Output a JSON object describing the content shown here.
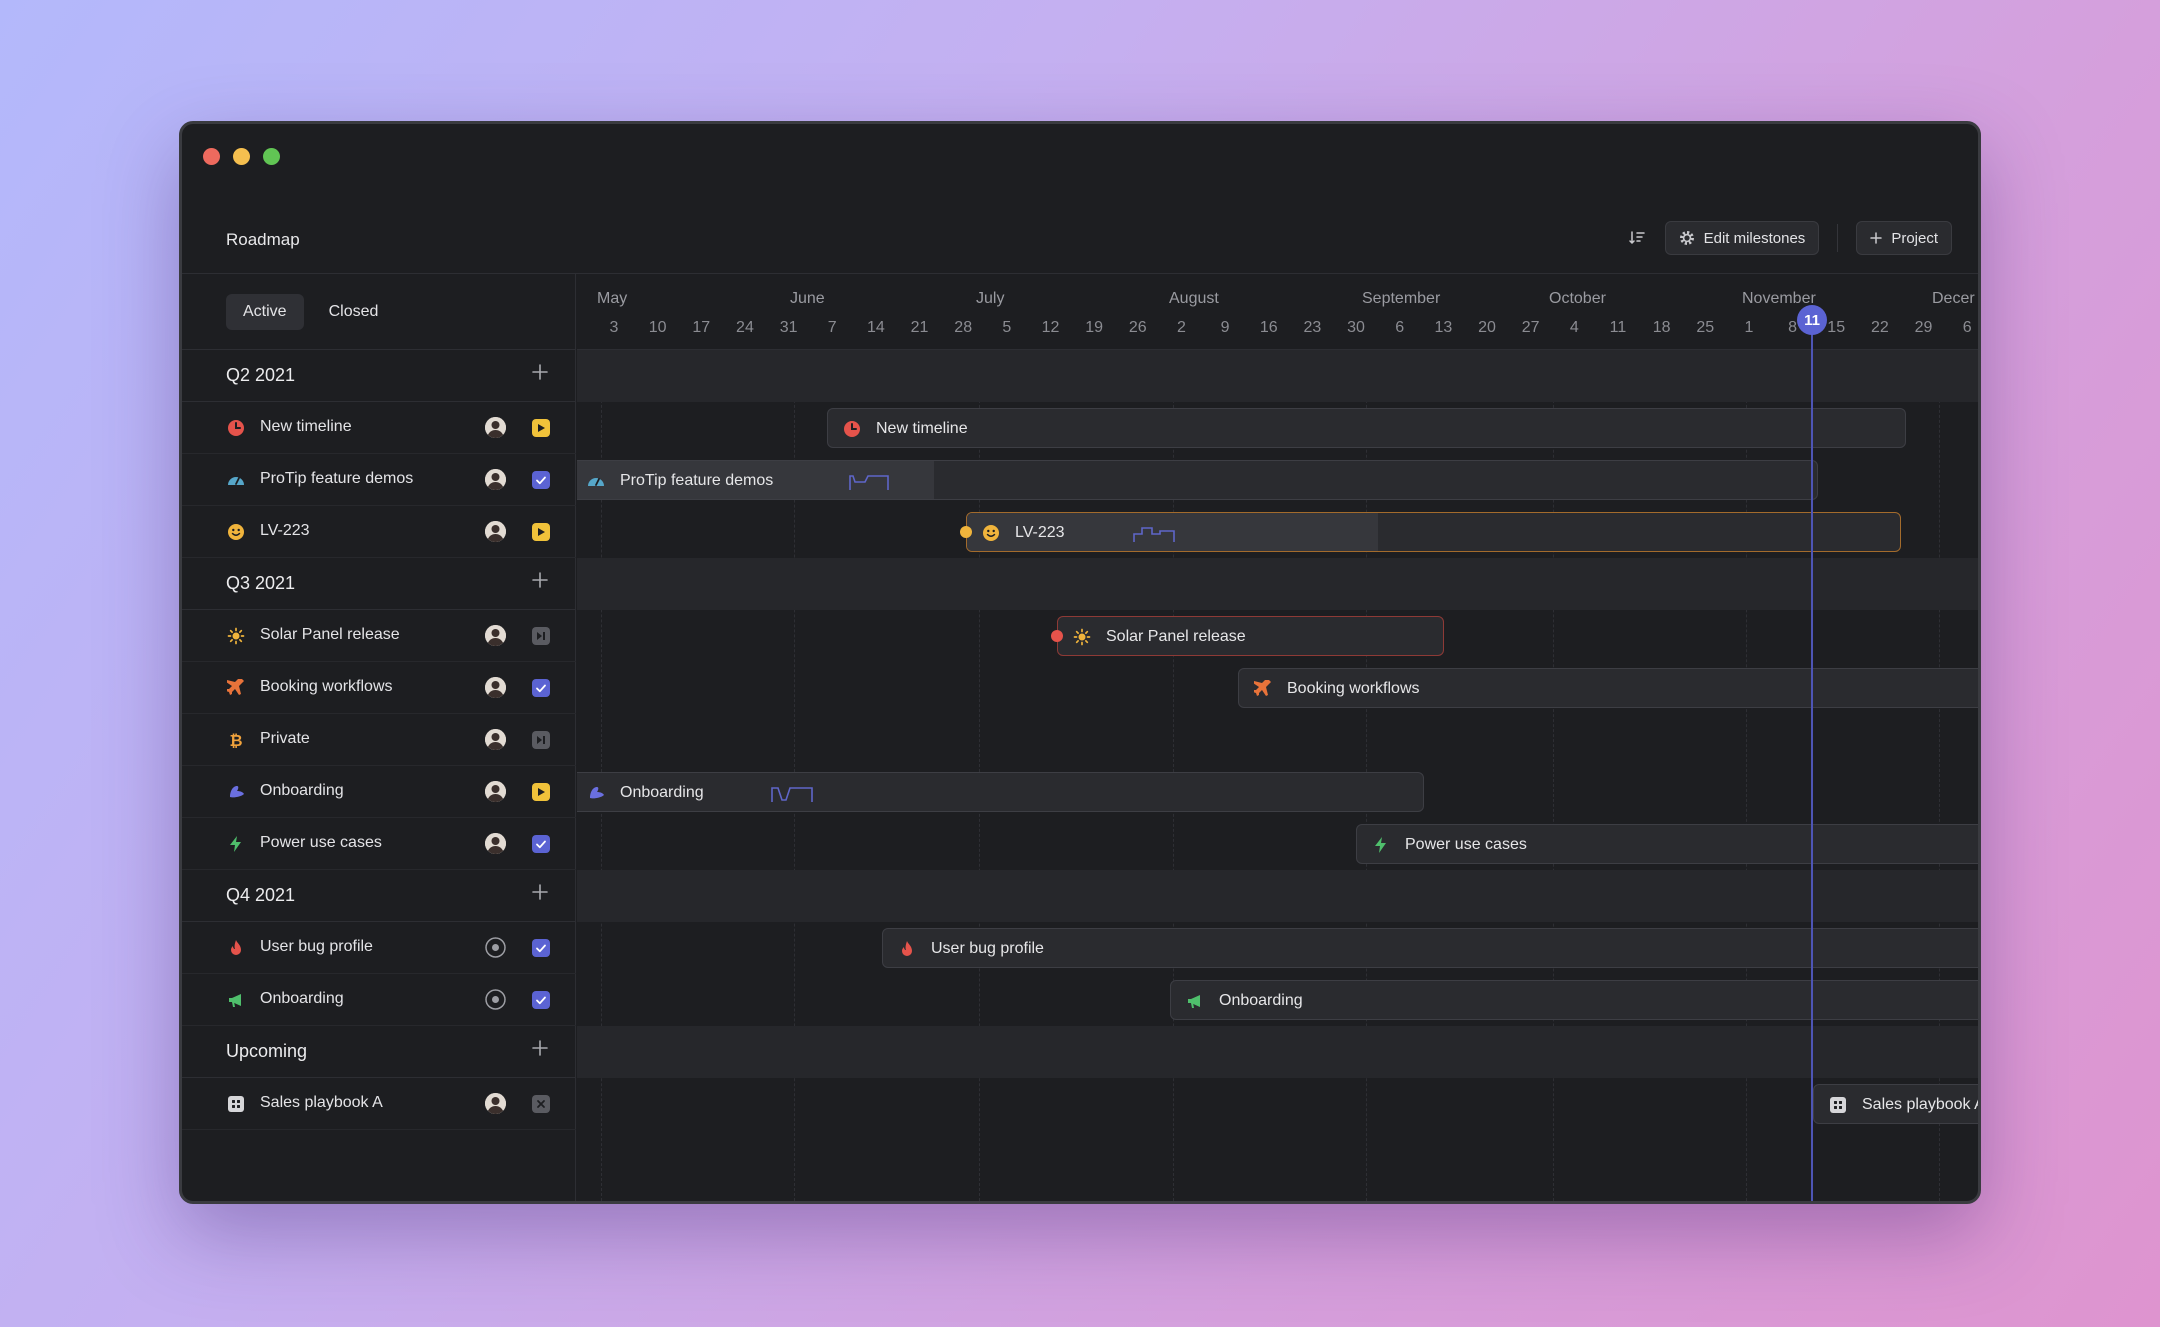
{
  "app": {
    "title": "Roadmap"
  },
  "header": {
    "edit_milestones": "Edit milestones",
    "project": "Project"
  },
  "tabs": [
    {
      "label": "Active"
    },
    {
      "label": "Closed"
    }
  ],
  "groups": [
    {
      "label": "Q2 2021"
    },
    {
      "label": "Q3 2021"
    },
    {
      "label": "Q4 2021"
    },
    {
      "label": "Upcoming"
    }
  ],
  "projects": [
    {
      "name": "New timeline",
      "icon": "clock-icon",
      "status": "in-progress",
      "color": "#e5534b"
    },
    {
      "name": "ProTip feature demos",
      "icon": "gauge-icon",
      "status": "done",
      "color": "#56a6c9"
    },
    {
      "name": "LV-223",
      "icon": "smile-icon",
      "status": "in-progress",
      "color": "#f0b43c"
    },
    {
      "name": "Solar Panel release",
      "icon": "sun-icon",
      "status": "paused",
      "color": "#f0b43c"
    },
    {
      "name": "Booking workflows",
      "icon": "plane-icon",
      "status": "done",
      "color": "#e8733a"
    },
    {
      "name": "Private",
      "icon": "bitcoin-icon",
      "status": "paused",
      "color": "#f0a23c"
    },
    {
      "name": "Onboarding",
      "icon": "hat-icon",
      "status": "in-progress",
      "color": "#6a6fe0"
    },
    {
      "name": "Power use cases",
      "icon": "bolt-icon",
      "status": "done",
      "color": "#4fbf6c"
    },
    {
      "name": "User bug profile",
      "icon": "flame-icon",
      "status": "done",
      "color": "#e5534b"
    },
    {
      "name": "Onboarding",
      "icon": "megaphone-icon",
      "status": "done",
      "color": "#4fbf6c"
    },
    {
      "name": "Sales playbook A",
      "icon": "grid-icon",
      "status": "cancelled",
      "color": "#d6d6d9"
    }
  ],
  "timeline": {
    "months": [
      "May",
      "June",
      "July",
      "August",
      "September",
      "October",
      "November",
      "Decer"
    ],
    "days": [
      "3",
      "10",
      "17",
      "24",
      "31",
      "7",
      "14",
      "21",
      "28",
      "5",
      "12",
      "19",
      "26",
      "2",
      "9",
      "16",
      "23",
      "30",
      "6",
      "13",
      "20",
      "27",
      "4",
      "11",
      "18",
      "25",
      "1",
      "8",
      "15",
      "22",
      "29",
      "6"
    ],
    "today": "11",
    "edge_day": "6"
  },
  "colors": {
    "accent": "#5b63d3",
    "in_progress": "#f0c23a",
    "done": "#5b63d3",
    "paused": "#5a5b61"
  }
}
